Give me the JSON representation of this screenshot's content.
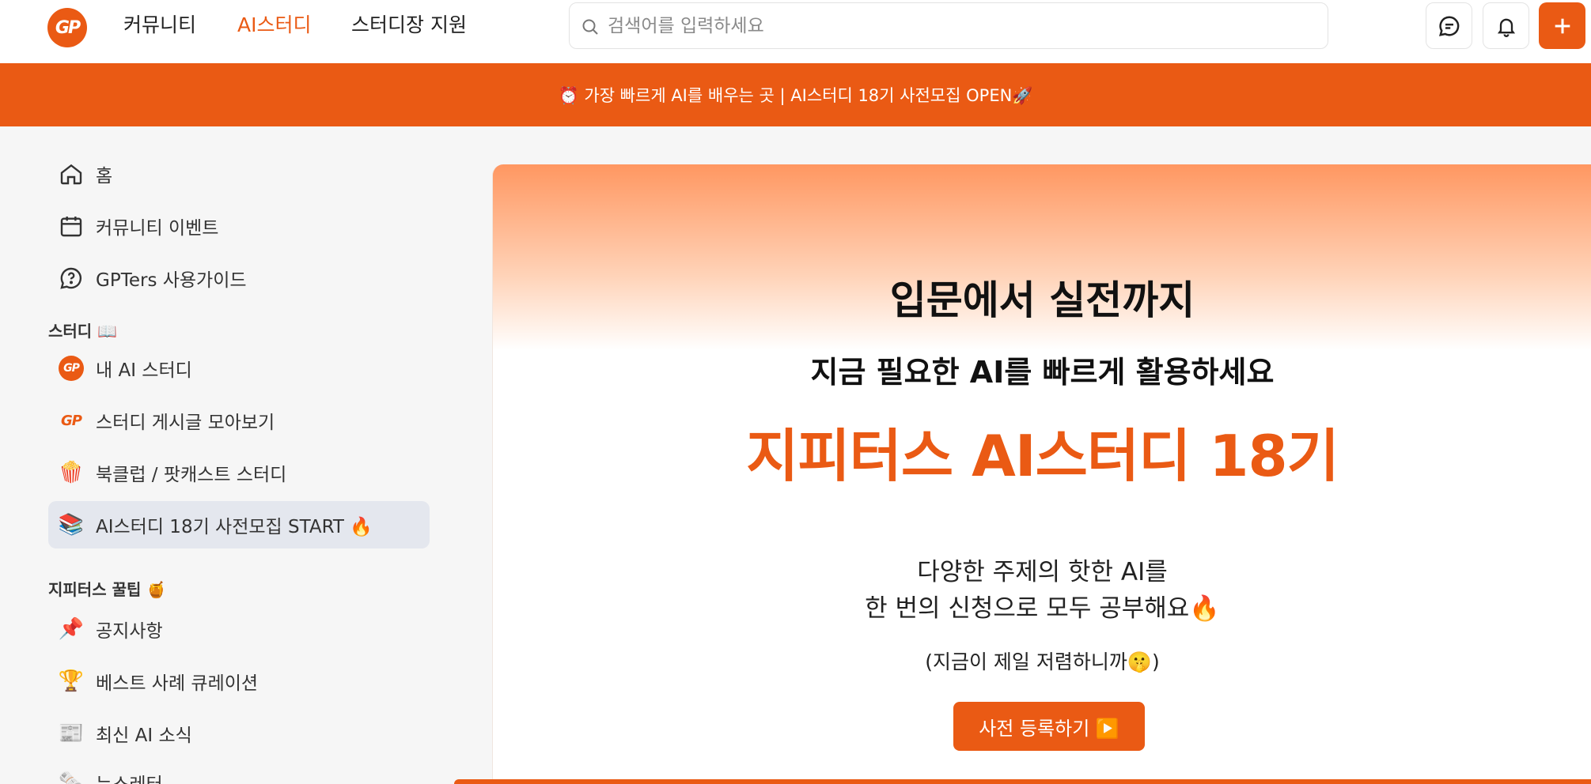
{
  "header": {
    "logo_text": "GP",
    "nav": [
      {
        "label": "커뮤니티"
      },
      {
        "label": "AI스터디"
      },
      {
        "label": "스터디장 지원"
      }
    ],
    "search_placeholder": "검색어를 입력하세요",
    "accent_color": "#ea5a14"
  },
  "banner": {
    "text": "⏰ 가장 빠르게 AI를 배우는 곳 | AI스터디 18기 사전모집 OPEN🚀"
  },
  "sidebar": {
    "top_items": [
      {
        "label": "홈",
        "icon": "home-icon"
      },
      {
        "label": "커뮤니티 이벤트",
        "icon": "calendar-icon"
      },
      {
        "label": "GPTers 사용가이드",
        "icon": "help-chat-icon"
      }
    ],
    "study_section": "스터디 📖",
    "study_items": [
      {
        "label": "내 AI 스터디",
        "icon": "gp-logo-icon"
      },
      {
        "label": "스터디 게시글 모아보기",
        "icon": "gp-logo-icon"
      },
      {
        "label": "북클럽 / 팟캐스트 스터디",
        "icon": "🍿"
      },
      {
        "label": "AI스터디 18기 사전모집 START 🔥",
        "icon": "📚"
      }
    ],
    "tips_section": "지피터스 꿀팁 🍯",
    "tips_items": [
      {
        "label": "공지사항",
        "icon": "📌"
      },
      {
        "label": "베스트 사례 큐레이션",
        "icon": "🏆"
      },
      {
        "label": "최신 AI 소식",
        "icon": "📰"
      },
      {
        "label": "뉴스레터",
        "icon": "🗞️"
      }
    ]
  },
  "hero": {
    "title": "입문에서 실전까지",
    "subtitle": "지금 필요한 AI를 빠르게 활용하세요",
    "headline": "지피터스 AI스터디 18기",
    "desc_line1": "다양한 주제의 핫한 AI를",
    "desc_line2": "한 번의 신청으로 모두 공부해요🔥",
    "note": "(지금이 제일 저렴하니까🤫)",
    "cta_label": "사전 등록하기 ▶️"
  }
}
